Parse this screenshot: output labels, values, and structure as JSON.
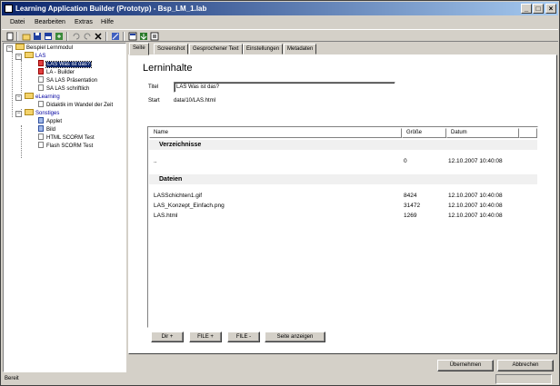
{
  "window": {
    "title": "Learning Application Builder (Prototyp) - Bsp_LM_1.lab",
    "min": "_",
    "max": "□",
    "close": "×"
  },
  "menu": [
    "Datei",
    "Bearbeiten",
    "Extras",
    "Hilfe"
  ],
  "tree": {
    "root": "Beispiel Lernmodul",
    "nodes": [
      {
        "label": "LAS"
      },
      {
        "label": "LAS Was ist das?"
      },
      {
        "label": "LA - Builder"
      },
      {
        "label": "SA LAS Präsentation"
      },
      {
        "label": "SA LAS schriftlich"
      },
      {
        "label": "eLearning"
      },
      {
        "label": "Didaktik im Wandel der Zeit"
      },
      {
        "label": "Sonstiges"
      },
      {
        "label": "Applet"
      },
      {
        "label": "Bild"
      },
      {
        "label": "HTML SCORM Test"
      },
      {
        "label": "Flash SCORM Test"
      }
    ]
  },
  "tabs": [
    "Seite",
    "Screenshot",
    "Gesprochener Text",
    "Einstellungen",
    "Metadaten"
  ],
  "content": {
    "heading": "Lerninhalte",
    "title_label": "Titel",
    "title_value": "LAS Was ist das?",
    "start_label": "Start",
    "start_value": "data/10/LAS.html"
  },
  "list": {
    "columns": [
      "Name",
      "Größe",
      "Datum"
    ],
    "section_dirs": "Verzeichnisse",
    "dirs": [
      {
        "name": "..",
        "size": "0",
        "date": "12.10.2007 10:40:08"
      }
    ],
    "section_files": "Dateien",
    "files": [
      {
        "name": "LASSchichten1.gif",
        "size": "8424",
        "date": "12.10.2007 10:40:08"
      },
      {
        "name": "LAS_Konzept_Einfach.png",
        "size": "31472",
        "date": "12.10.2007 10:40:08"
      },
      {
        "name": "LAS.html",
        "size": "1269",
        "date": "12.10.2007 10:40:08"
      }
    ]
  },
  "buttons": {
    "dir_add": "Dir +",
    "file_add": "FILE +",
    "file_remove": "FILE -",
    "show_page": "Seite anzeigen",
    "apply": "Übernehmen",
    "cancel": "Abbrechen"
  },
  "status": {
    "text": "Bereit"
  }
}
